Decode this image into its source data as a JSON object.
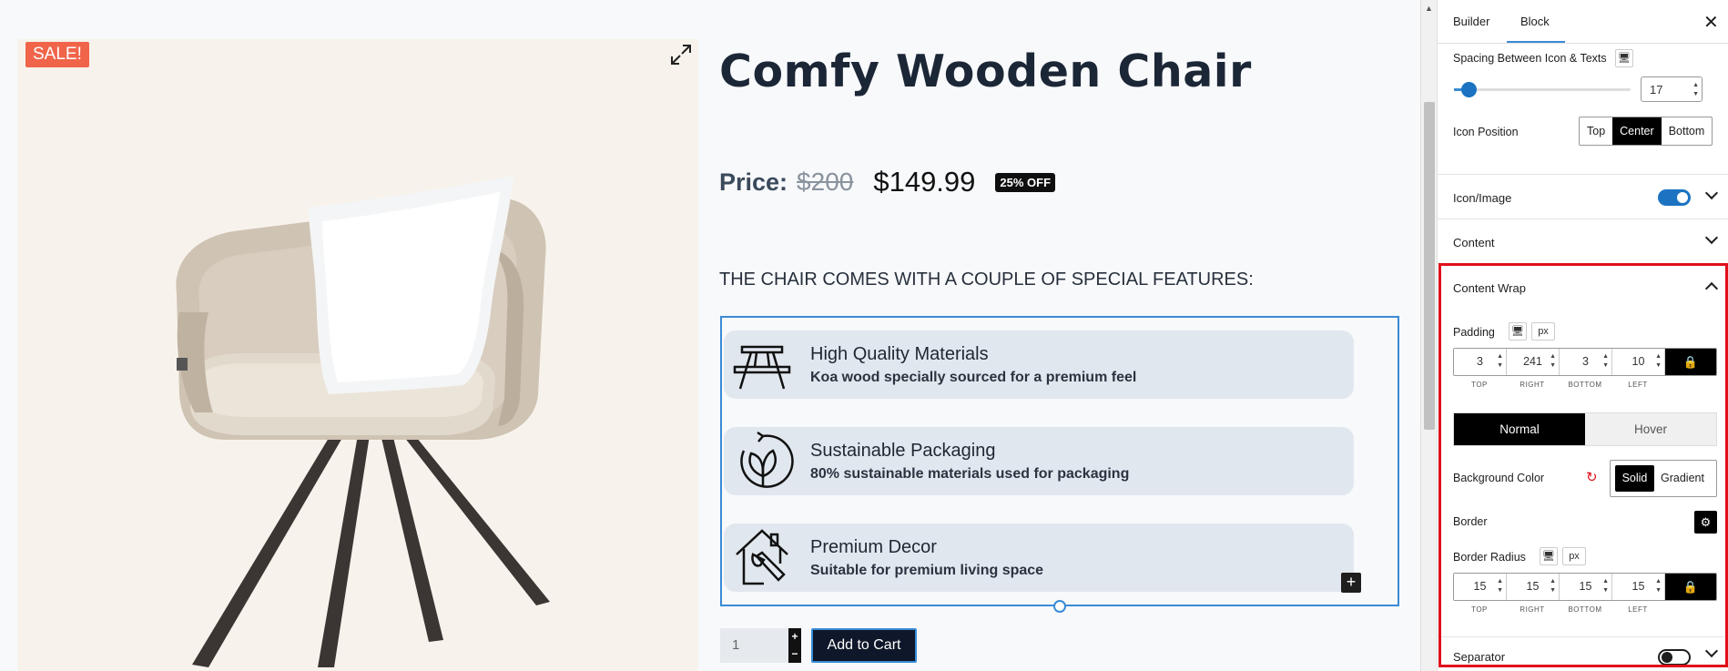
{
  "product": {
    "sale_badge": "SALE!",
    "title": "Comfy Wooden Chair",
    "price_label": "Price:",
    "price_old": "$200",
    "price_new": "$149.99",
    "discount_badge": "25% OFF",
    "features_heading": "THE CHAIR COMES WITH A COUPLE OF SPECIAL FEATURES:",
    "features": [
      {
        "icon": "picnic-table-icon",
        "title": "High Quality Materials",
        "desc": "Koa wood specially sourced for a premium feel"
      },
      {
        "icon": "leaf-recycle-icon",
        "title": "Sustainable Packaging",
        "desc": "80% sustainable materials used for packaging"
      },
      {
        "icon": "house-brush-icon",
        "title": "Premium Decor",
        "desc": "Suitable for premium living space"
      }
    ],
    "quantity": "1",
    "add_to_cart": "Add to Cart"
  },
  "panel": {
    "tabs": [
      "Builder",
      "Block"
    ],
    "active_tab": "Block",
    "spacing_label": "Spacing Between Icon & Texts",
    "spacing_value": "17",
    "icon_position_label": "Icon Position",
    "icon_position_options": [
      "Top",
      "Center",
      "Bottom"
    ],
    "icon_position_selected": "Center",
    "icon_image_label": "Icon/Image",
    "content_label": "Content",
    "content_wrap_label": "Content Wrap",
    "padding_label": "Padding",
    "unit": "px",
    "padding": [
      "3",
      "241",
      "3",
      "10"
    ],
    "side_labels": [
      "TOP",
      "RIGHT",
      "BOTTOM",
      "LEFT"
    ],
    "state_tabs": [
      "Normal",
      "Hover"
    ],
    "state_selected": "Normal",
    "bg_color_label": "Background Color",
    "bg_types": [
      "Solid",
      "Gradient"
    ],
    "bg_type_selected": "Solid",
    "border_label": "Border",
    "border_radius_label": "Border Radius",
    "border_radius": [
      "15",
      "15",
      "15",
      "15"
    ],
    "separator_label": "Separator"
  },
  "colors": {
    "accent": "#3a8bd5",
    "sale": "#f0654a",
    "highlight_frame": "#e0101a"
  }
}
